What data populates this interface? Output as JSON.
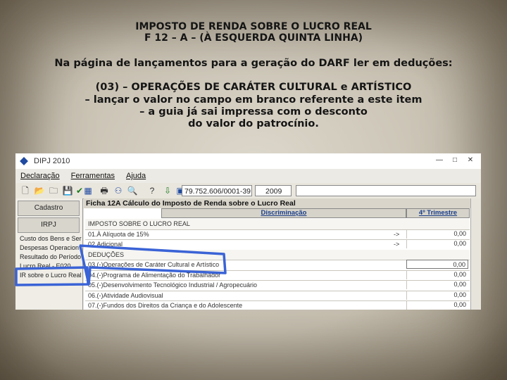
{
  "slide": {
    "title_line1": "IMPOSTO DE RENDA SOBRE O LUCRO REAL",
    "title_line2": "F 12 – A – (À ESQUERDA QUINTA LINHA)",
    "instruction": "Na página de lançamentos para a geração do DARF ler em deduções:",
    "section": "(03) – OPERAÇÕES DE CARÁTER CULTURAL e ARTÍSTICO",
    "body_line1": "– lançar o valor no campo em branco referente a este item",
    "body_line2": "– a guia já sai impressa com o desconto",
    "body_line3": "do valor do patrocínio."
  },
  "window": {
    "title": "DIPJ 2010",
    "controls": {
      "minimize": "—",
      "maximize": "□",
      "close": "✕"
    }
  },
  "menu": [
    "Declaração",
    "Ferramentas",
    "Ajuda"
  ],
  "toolbar": {
    "cnpj": "79.752.606/0001-39",
    "year": "2009",
    "icons": [
      "new-icon",
      "open-icon",
      "folder-icon",
      "save-icon",
      "check-icon",
      "list-icon",
      "print-icon",
      "network-icon",
      "search-icon",
      "help-icon",
      "import-icon",
      "export-icon"
    ]
  },
  "left_panel": {
    "cadastro_button": "Cadastro",
    "irpj_button": "IRPJ",
    "items": [
      "Custo dos Bens e Ser",
      "Despesas Operacion",
      "Resultado do Período",
      "Lucro Real - E020",
      "IR sobre o Lucro Real"
    ]
  },
  "main": {
    "ficha_title": "Ficha 12A   Cálculo do Imposto de Renda sobre o Lucro Real",
    "col_discriminacao": "Discriminação",
    "col_trimestre": "4º Trimestre",
    "rows": [
      {
        "label": "IMPOSTO SOBRE O LUCRO REAL",
        "value": "",
        "arrow": "",
        "group": true
      },
      {
        "label": "01.À Alíquota de 15%",
        "value": "0,00",
        "arrow": "->",
        "group": false
      },
      {
        "label": "02.Adicional",
        "value": "0,00",
        "arrow": "->",
        "group": false
      },
      {
        "label": "DEDUÇÕES",
        "value": "",
        "arrow": "",
        "group": true
      },
      {
        "label": "03.(-)Operações de Caráter Cultural e Artístico",
        "value": "0,00",
        "arrow": "",
        "group": false,
        "blank": true
      },
      {
        "label": "04.(-)Programa de Alimentação do Trabalhador",
        "value": "0,00",
        "arrow": "",
        "group": false
      },
      {
        "label": "05.(-)Desenvolvimento Tecnológico Industrial / Agropecuário",
        "value": "0,00",
        "arrow": "",
        "group": false
      },
      {
        "label": "06.(-)Atividade Audiovisual",
        "value": "0,00",
        "arrow": "",
        "group": false
      },
      {
        "label": "07.(-)Fundos dos Direitos da Criança e do Adolescente",
        "value": "0,00",
        "arrow": "",
        "group": false
      }
    ]
  },
  "colors": {
    "highlight": "#3a63d6",
    "ficha_header": "#1a3e8a"
  }
}
